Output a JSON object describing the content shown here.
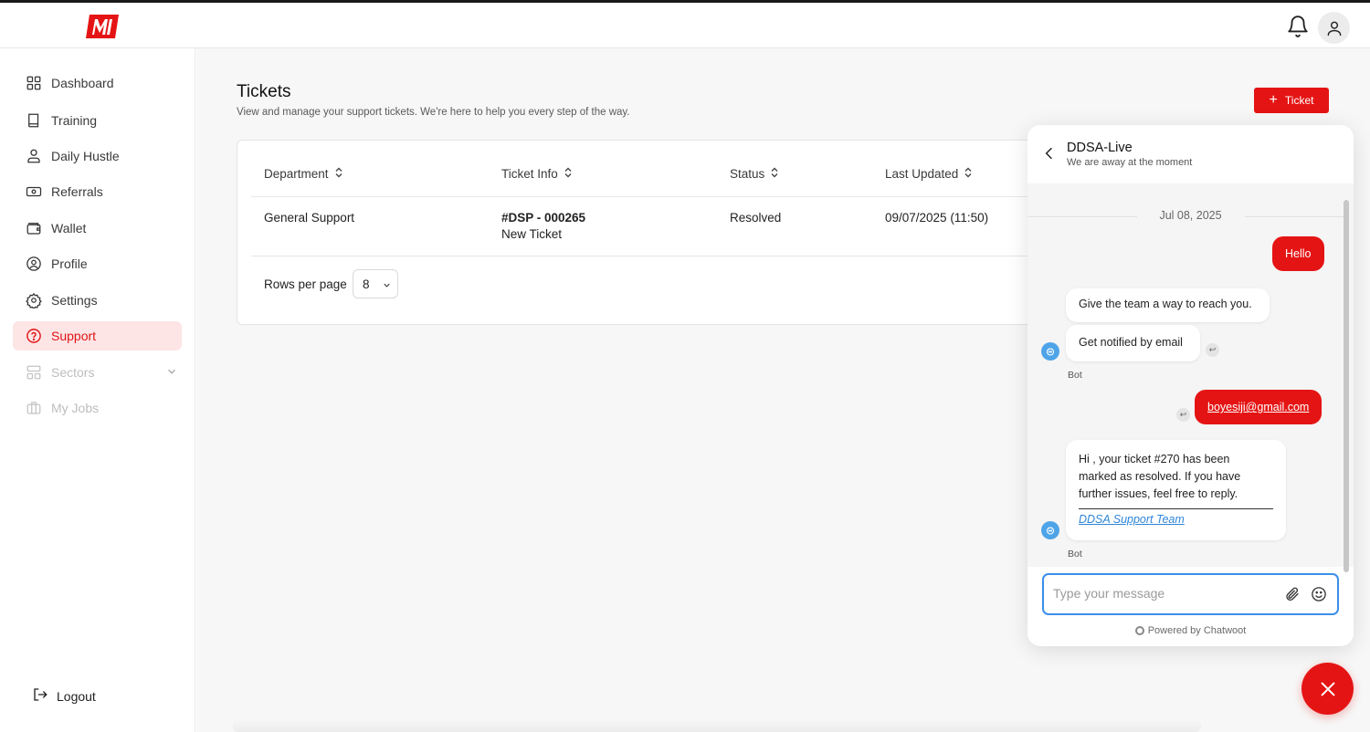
{
  "brand": {
    "logo_text": "MI",
    "accent": "#e51414"
  },
  "header": {
    "bell_icon": "bell-icon",
    "avatar_icon": "user-icon"
  },
  "sidebar": {
    "items": [
      {
        "label": "Dashboard",
        "icon": "grid-icon"
      },
      {
        "label": "Training",
        "icon": "book-icon"
      },
      {
        "label": "Daily Hustle",
        "icon": "user-pin-icon"
      },
      {
        "label": "Referrals",
        "icon": "cash-icon"
      },
      {
        "label": "Wallet",
        "icon": "wallet-icon"
      },
      {
        "label": "Profile",
        "icon": "user-circle-icon"
      },
      {
        "label": "Settings",
        "icon": "gear-icon"
      },
      {
        "label": "Support",
        "icon": "help-circle-icon",
        "active": true
      },
      {
        "label": "Sectors",
        "icon": "layout-icon",
        "disabled": true
      },
      {
        "label": "My Jobs",
        "icon": "briefcase-icon",
        "disabled": true
      }
    ],
    "logout": "Logout"
  },
  "page": {
    "title": "Tickets",
    "subtitle": "View and manage your support tickets. We're here to help you every step of the way.",
    "add_button": "Ticket"
  },
  "table": {
    "columns": [
      "Department",
      "Ticket Info",
      "Status",
      "Last Updated"
    ],
    "rows": [
      {
        "department": "General Support",
        "ticket_id": "#DSP - 000265",
        "ticket_title": "New Ticket",
        "status": "Resolved",
        "updated": "09/07/2025 (11:50)"
      }
    ],
    "rows_per_page_label": "Rows per page",
    "rows_per_page_value": "8"
  },
  "chat": {
    "title": "DDSA-Live",
    "subtitle": "We are away at the moment",
    "date": "Jul 08, 2025",
    "messages": {
      "m1": "Hello",
      "m2": "Give the team a way to reach you.",
      "m3": "Get notified by email",
      "m4": "boyesiji@gmail.com",
      "m5_line1": "Hi , your ticket #270 has been",
      "m5_line2": "marked as resolved. If you have",
      "m5_line3": "further issues, feel free to reply.",
      "m5_sign": "DDSA Support Team"
    },
    "bot_label": "Bot",
    "input_placeholder": "Type your message",
    "powered_by": "Powered by Chatwoot"
  }
}
